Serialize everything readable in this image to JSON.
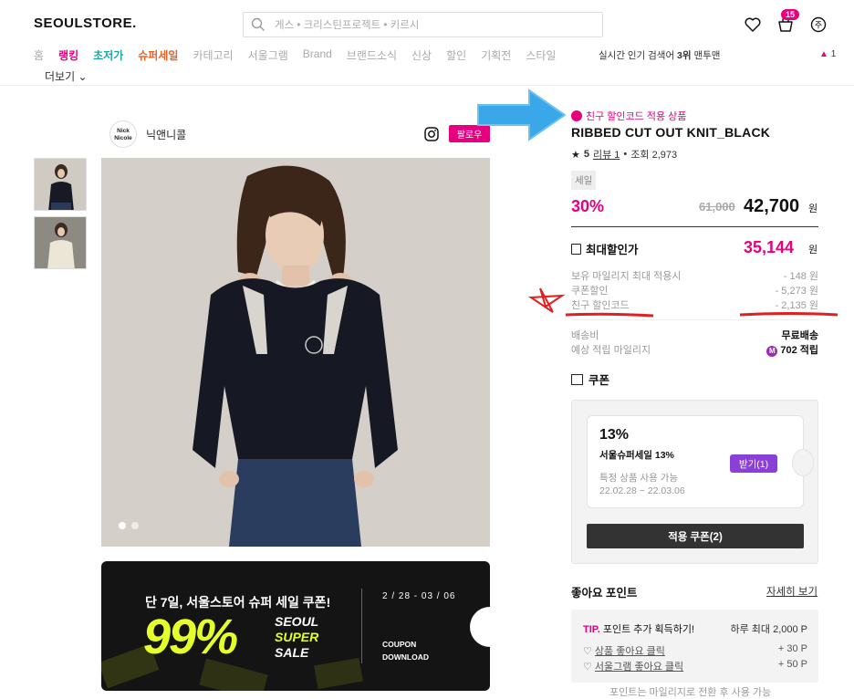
{
  "header": {
    "logo": "SEOULSTORE.",
    "search_placeholder": "게스 • 크리스틴프로젝트 • 키르시",
    "cart_count": "15"
  },
  "nav": {
    "items": [
      {
        "label": "홈",
        "style": "grey"
      },
      {
        "label": "랭킹",
        "style": "pink"
      },
      {
        "label": "초저가",
        "style": "teal"
      },
      {
        "label": "슈퍼세일",
        "style": "orange"
      },
      {
        "label": "카테고리",
        "style": "grey"
      },
      {
        "label": "서울그램",
        "style": "grey"
      },
      {
        "label": "Brand",
        "style": "grey"
      },
      {
        "label": "브랜드소식",
        "style": "grey"
      },
      {
        "label": "신상",
        "style": "grey"
      },
      {
        "label": "할인",
        "style": "grey"
      },
      {
        "label": "기획전",
        "style": "grey"
      },
      {
        "label": "스타일",
        "style": "grey"
      }
    ],
    "more": "더보기",
    "hot_label": "실시간 인기 검색어",
    "hot_rank": "3위",
    "hot_term": "맨투맨",
    "rank_change": "1"
  },
  "brand": {
    "logo_text": "Nick Nicole",
    "name": "닉앤니콜",
    "follow": "팔로우"
  },
  "banner": {
    "title": "단 7일, 서울스토어 슈퍼 세일 쿠폰!",
    "big": "99%",
    "sub1": "SEOUL",
    "sub2": "SUPER",
    "sub3": "SALE",
    "date": "2 / 28 - 03 / 06",
    "coupon1": "COUPON",
    "coupon2": "DOWNLOAD"
  },
  "product": {
    "friend_tag": "친구 할인코드 적용 상품",
    "title": "RIBBED CUT OUT KNIT_BLACK",
    "rating": "5",
    "review": "리뷰 1",
    "views": "조회 2,973",
    "sale_badge": "세일",
    "discount": "30%",
    "original": "61,000",
    "price": "42,700",
    "unit": "원",
    "max_label": "최대할인가",
    "max_price": "35,144",
    "discounts": [
      {
        "label": "보유 마일리지 최대 적용시",
        "value": "- 148 원"
      },
      {
        "label": "쿠폰할인",
        "value": "- 5,273 원"
      },
      {
        "label": "친구 할인코드",
        "value": "- 2,135 원"
      }
    ],
    "shipping_label": "배송비",
    "shipping_value": "무료배송",
    "mileage_label": "예상 적립 마일리지",
    "mileage_value": "702 적립"
  },
  "coupon": {
    "heading": "쿠폰",
    "pct": "13%",
    "name": "서울슈퍼세일 13%",
    "desc": "특정 상품 사용 가능",
    "dates": "22.02.28 ~ 22.03.06",
    "get": "받기(1)",
    "apply": "적용 쿠폰(2)"
  },
  "likes": {
    "heading": "좋아요 포인트",
    "more": "자세히 보기",
    "tip_prefix": "TIP.",
    "tip_title": "포인트 추가 획득하기!",
    "tip_max": "하루 최대 2,000 P",
    "rows": [
      {
        "label": "상품 좋아요 클릭",
        "value": "+ 30 P"
      },
      {
        "label": "서울그램 좋아요 클릭",
        "value": "+ 50 P"
      }
    ],
    "note": "포인트는 마일리지로 전환 후 사용 가능"
  },
  "colors": {
    "accent": "#e6007e",
    "purple": "#8b3fd9",
    "banner_yellow": "#e5ff2a"
  }
}
